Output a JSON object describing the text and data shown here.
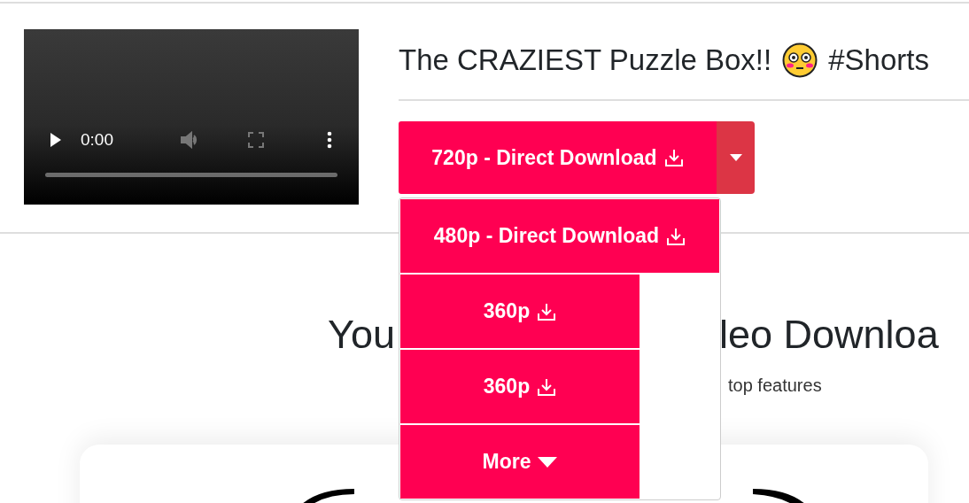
{
  "video": {
    "time": "0:00"
  },
  "title": {
    "parts": [
      "The CRAZIEST Puzzle Box!!",
      "#Shorts"
    ]
  },
  "download": {
    "main": "720p - Direct Download",
    "expanded": true,
    "options": [
      {
        "label": "480p - Direct Download",
        "kind": "wide"
      },
      {
        "label": "360p",
        "kind": "narrow"
      },
      {
        "label": "360p",
        "kind": "narrow"
      },
      {
        "label": "More",
        "kind": "more"
      }
    ]
  },
  "hero": {
    "heading_left": "You",
    "heading_right": "leo Downloa",
    "subtitle": "top features"
  }
}
